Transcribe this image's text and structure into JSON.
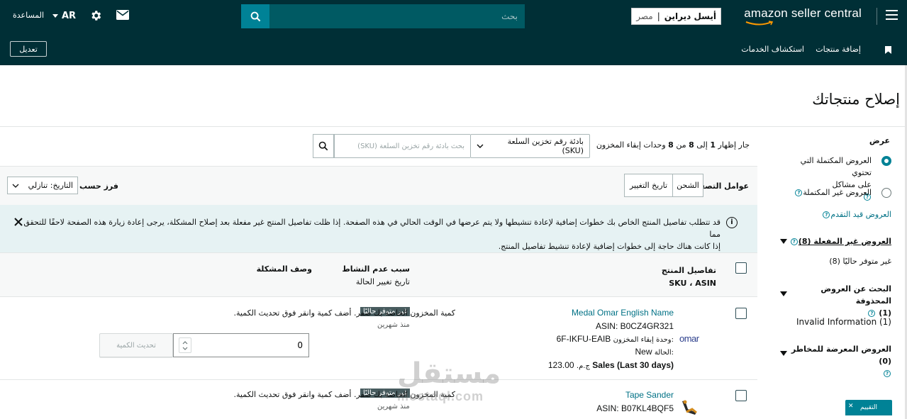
{
  "topnav": {
    "logo_text": "amazon seller central",
    "store": {
      "name": "أيسل ديراين",
      "country": "مصر"
    },
    "search_placeholder": "بحث",
    "lang": "AR",
    "help": "المساعدة",
    "bg_color": "#002f36",
    "accent_color": "#008296"
  },
  "subnav": {
    "links": [
      "إضافة منتجات",
      "استكشاف الخدمات"
    ],
    "edit_button": "تعديل"
  },
  "page": {
    "title": "إصلاح منتجاتك"
  },
  "sidebar": {
    "heading": "عرض",
    "radio_options": [
      {
        "label_line1": "العروض المكتملة التي تحتوي",
        "label_line2": "على مشاكل",
        "checked": true
      },
      {
        "label_line1": "العروض غير المكتملة",
        "checked": false
      }
    ],
    "in_progress": "العروض قيد التقدم",
    "sections": [
      {
        "title": "العروض غير المفعلة (8)",
        "sub": "غير متوفر حاليًا (8)"
      },
      {
        "title_line1": "البحث عن العروض المحذوفة",
        "title_line2": "(1)",
        "sub": "Invalid Information (1)"
      },
      {
        "title": "العروض المعرضة للمخاطر (0)"
      }
    ]
  },
  "toolbar": {
    "showing": {
      "prefix": "جار إظهار",
      "from": "1",
      "mid": "إلى",
      "to": "8",
      "of": "من",
      "total": "8",
      "suffix": "وحدات إبقاء المخزون"
    },
    "sku_select": "بادئة رقم تخزين السلعة (SKU)",
    "sku_search_placeholder": "بحث بادئة رقم تخزين السلعة (SKU)"
  },
  "filters": {
    "label": "عوامل التصفية",
    "buttons": [
      "الشحن",
      "تاريخ التغيير"
    ],
    "sort_label": "فرز حسب",
    "sort_value": "التاريخ: تنازلي"
  },
  "alert": {
    "line1": "قد تتطلب تفاصيل المنتج الخاص بك خطوات إضافية لإعادة تنشيطها ولا يتم عرضها في الوقت الحالي في هذه الصفحة. إذا ظلت تفاصيل المنتج غير مفعلة بعد إصلاح المشكلة، يرجى إعادة زيارة هذه الصفحة لاحقًا للتحقق مما",
    "line2": "إذا كانت هناك حاجة إلى خطوات إضافية لإعادة تنشيط تفاصيل المنتج."
  },
  "table": {
    "headers": {
      "details": "تفاصيل المنتج",
      "details_sub": "SKU ، ASIN",
      "reason": "سبب عدم النشاط",
      "reason_sub": "تاريخ تغيير الحالة",
      "problem": "وصف المشكلة"
    },
    "rows": [
      {
        "name": "Medal Omar English Name",
        "asin": "ASIN: B0CZ4GR321",
        "sku_label": "وحدة إبقاء المخزون:",
        "sku": "6F-IKFU-EAIB",
        "condition_label": "الحالة:",
        "condition": "New",
        "sales_value": "123.00",
        "sales_currency": "ج.م.",
        "sales_label": "Sales  (Last 30 days)",
        "badge": "غير متوفر حاليًا",
        "since": "منذ شهرين",
        "problem": "كمية المخزون الخاصة بك صفر. أضف كمية وانقر فوق تحديث الكمية.",
        "quantity": "0",
        "update_button": "تحديث الكمية",
        "thumb_text": "omar"
      },
      {
        "name": "Tape Sander",
        "asin": "ASIN: B07KL4BQF5",
        "badge": "غير متوفر حاليًا",
        "since": "منذ شهرين",
        "problem": "كمية المخزون الخاصة بك صفر. أضف كمية وانقر فوق تحديث الكمية."
      }
    ]
  },
  "feedback": {
    "label": "التقييم"
  },
  "watermark": {
    "arabic": "مستقل",
    "latin": "mostaql.com"
  }
}
